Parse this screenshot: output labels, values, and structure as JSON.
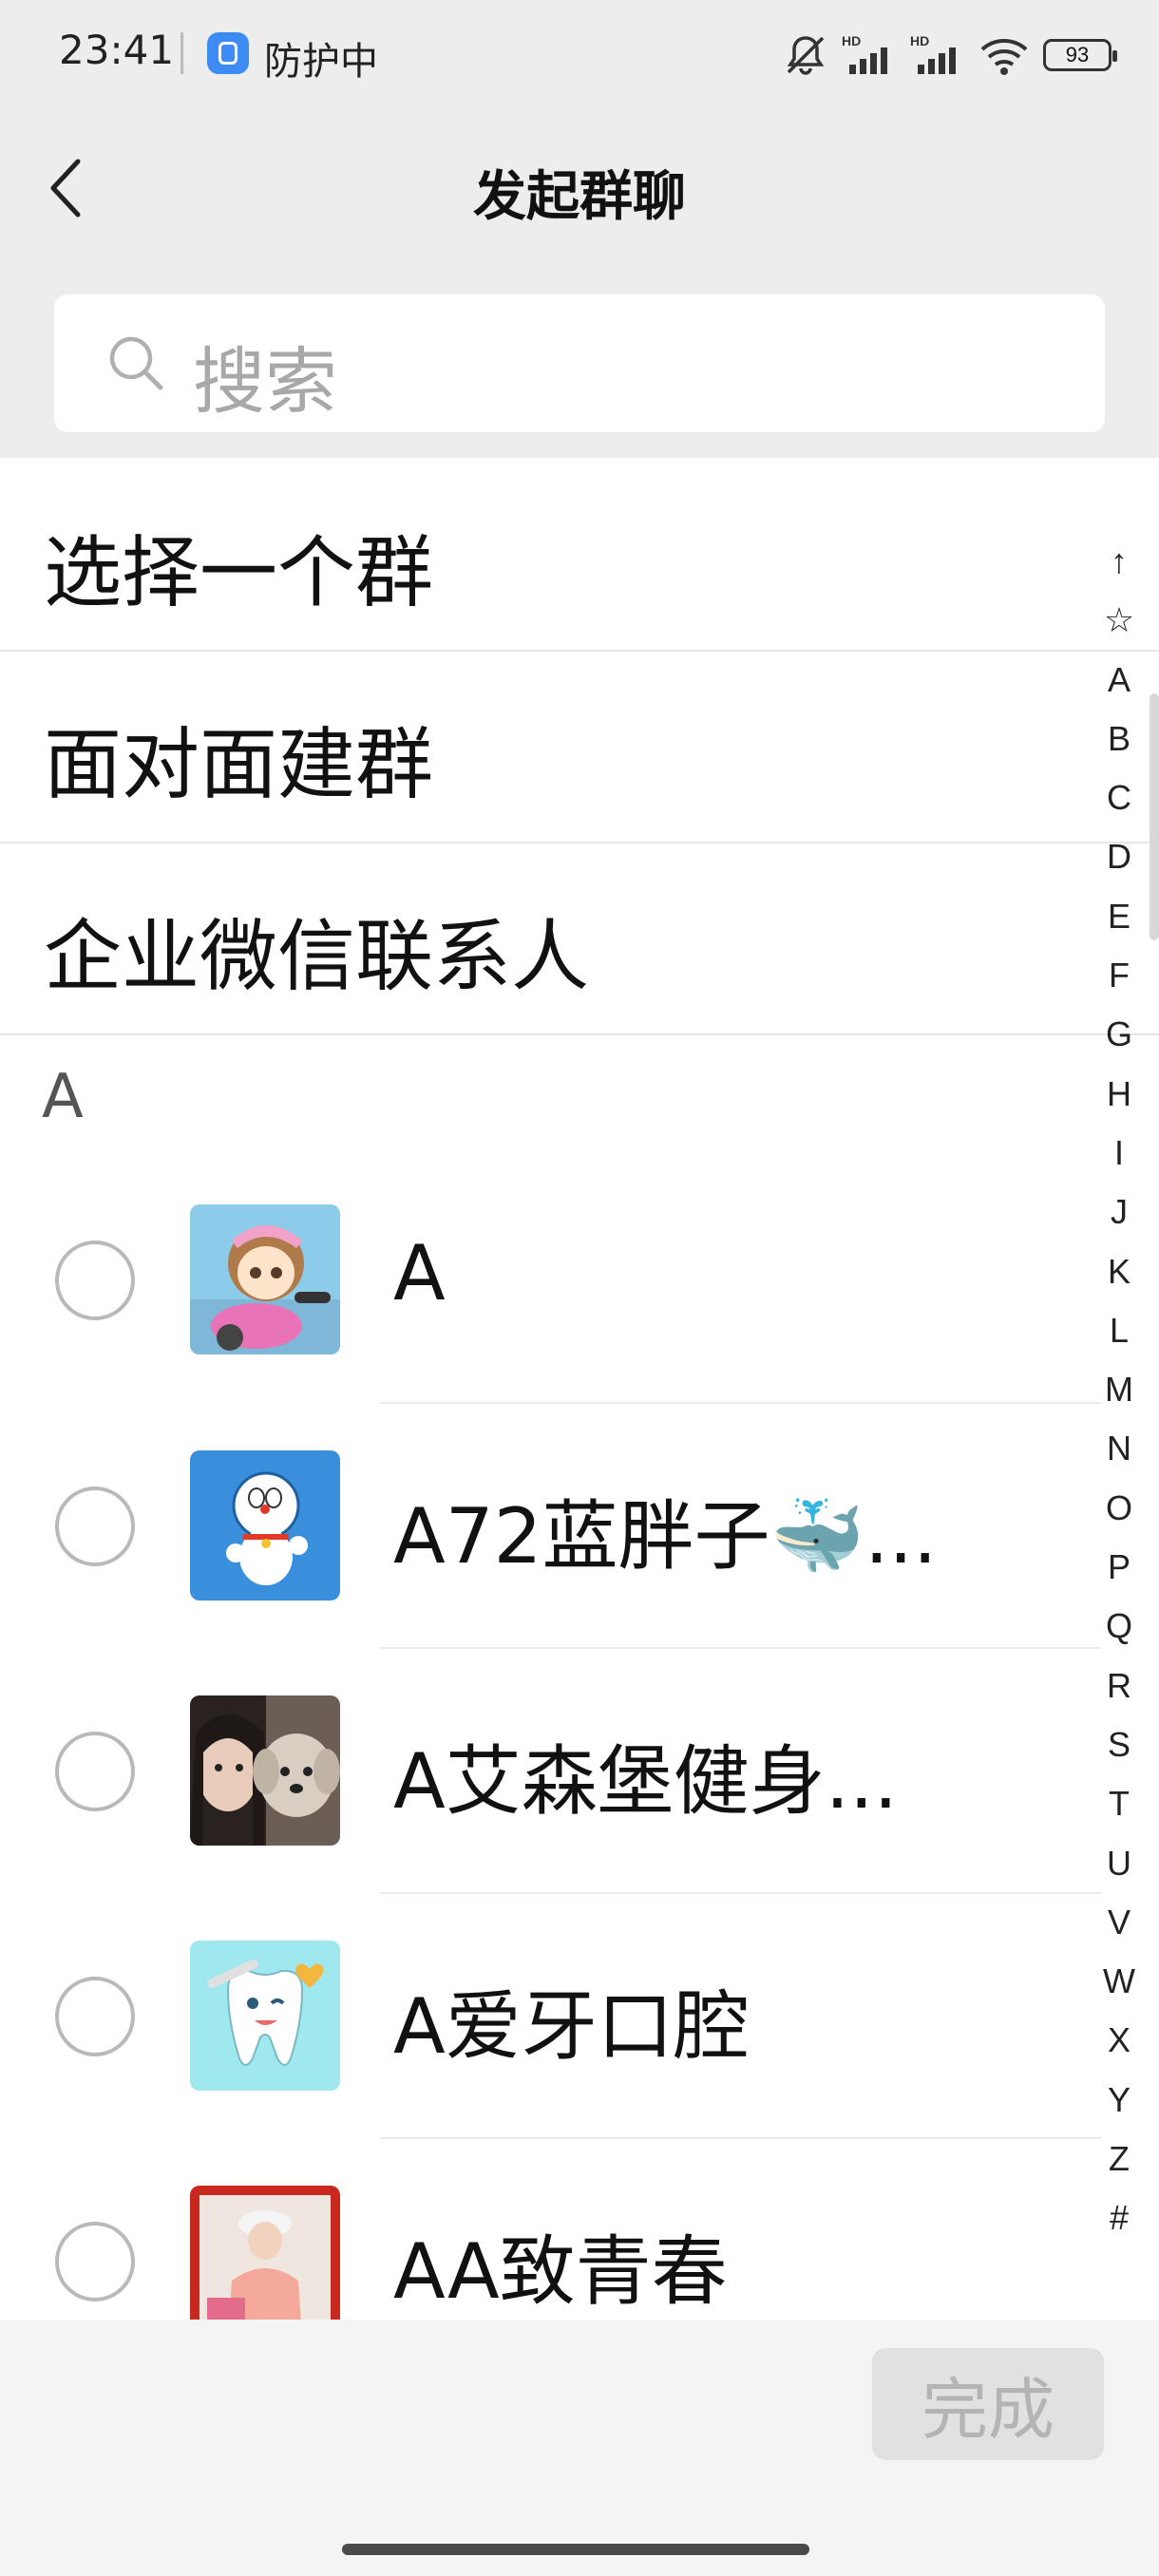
{
  "status_bar": {
    "time": "23:41",
    "app_status": "防护中",
    "battery": "93",
    "icons": [
      "mute-bell-icon",
      "hd-signal-icon",
      "hd-signal-icon",
      "wifi-icon",
      "battery-icon"
    ]
  },
  "header": {
    "title": "发起群聊",
    "back_icon": "chevron-left-icon"
  },
  "search": {
    "placeholder": "搜索",
    "icon": "search-icon"
  },
  "menu": [
    {
      "label": "选择一个群"
    },
    {
      "label": "面对面建群"
    },
    {
      "label": "企业微信联系人"
    }
  ],
  "section": {
    "letter": "A"
  },
  "contacts": [
    {
      "name": "A",
      "avatar": "anime-girl-scooter-avatar"
    },
    {
      "name": "A72蓝胖子🐳...",
      "avatar": "doraemon-avatar"
    },
    {
      "name": "A艾森堡健身...",
      "avatar": "girl-with-dog-avatar"
    },
    {
      "name": "A爱牙口腔",
      "avatar": "cartoon-tooth-avatar"
    },
    {
      "name": "AA致青春",
      "avatar": "girl-photo-avatar"
    }
  ],
  "index_letters": [
    "↑",
    "☆",
    "A",
    "B",
    "C",
    "D",
    "E",
    "F",
    "G",
    "H",
    "I",
    "J",
    "K",
    "L",
    "M",
    "N",
    "O",
    "P",
    "Q",
    "R",
    "S",
    "T",
    "U",
    "V",
    "W",
    "X",
    "Y",
    "Z",
    "#"
  ],
  "footer": {
    "done_label": "完成"
  },
  "colors": {
    "background_gray": "#ededed",
    "done_button_bg": "#e1e1e1",
    "done_button_text": "#b4b4b4",
    "radio_border": "#b9b9b9"
  }
}
